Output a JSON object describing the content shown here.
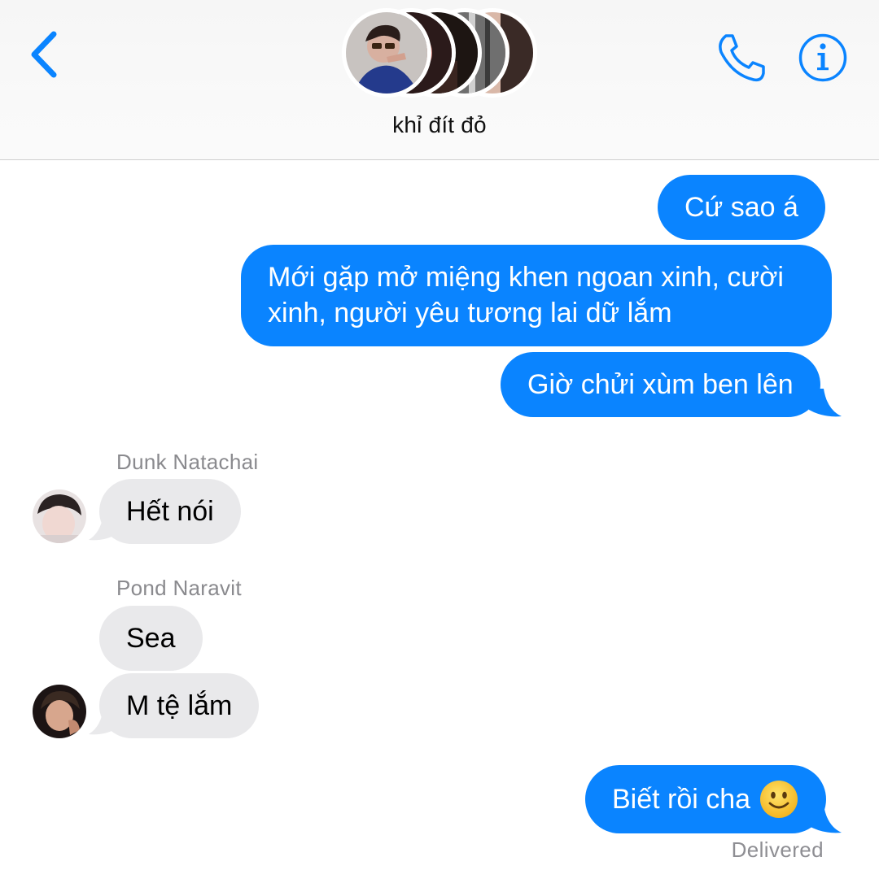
{
  "header": {
    "group_name": "khỉ đít đỏ",
    "accent_color": "#0a84ff",
    "icons": [
      "back-chevron-icon",
      "phone-icon",
      "info-icon"
    ]
  },
  "messages": [
    {
      "sender": "me",
      "text": "Cứ sao á"
    },
    {
      "sender": "me",
      "text": "Mới gặp mở miệng khen ngoan xinh, cười xinh, người yêu tương lai dữ lắm"
    },
    {
      "sender": "me",
      "text": "Giờ chửi xùm ben lên"
    },
    {
      "sender_name": "Dunk Natachai",
      "text": "Hết nói"
    },
    {
      "sender_name": "Pond Naravit",
      "text": "Sea"
    },
    {
      "sender_name": "Pond Naravit",
      "text": "M tệ lắm"
    },
    {
      "sender": "me",
      "text": "Biết rồi cha",
      "emoji": "slightly-smiling-face-icon"
    }
  ],
  "status": "Delivered",
  "colors": {
    "outgoing_bubble": "#0a84ff",
    "incoming_bubble": "#e9e9eb",
    "sender_label": "#8a8a8e"
  }
}
